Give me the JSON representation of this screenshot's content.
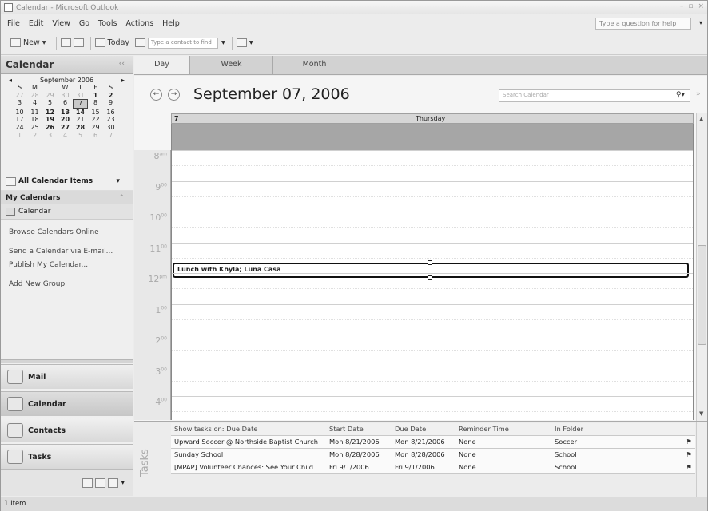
{
  "window": {
    "title": "Calendar - Microsoft Outlook"
  },
  "menu": {
    "items": [
      "File",
      "Edit",
      "View",
      "Go",
      "Tools",
      "Actions",
      "Help"
    ],
    "help_placeholder": "Type a question for help"
  },
  "toolbar": {
    "new_label": "New",
    "today_label": "Today",
    "contact_placeholder": "Type a contact to find"
  },
  "nav": {
    "header": "Calendar",
    "mini_calendar": {
      "month_label": "September 2006",
      "weekdays": [
        "S",
        "M",
        "T",
        "W",
        "T",
        "F",
        "S"
      ],
      "weeks": [
        [
          "27",
          "28",
          "29",
          "30",
          "31",
          "1",
          "2"
        ],
        [
          "3",
          "4",
          "5",
          "6",
          "7",
          "8",
          "9"
        ],
        [
          "10",
          "11",
          "12",
          "13",
          "14",
          "15",
          "16"
        ],
        [
          "17",
          "18",
          "19",
          "20",
          "21",
          "22",
          "23"
        ],
        [
          "24",
          "25",
          "26",
          "27",
          "28",
          "29",
          "30"
        ],
        [
          "1",
          "2",
          "3",
          "4",
          "5",
          "6",
          "7"
        ]
      ]
    },
    "all_items_label": "All Calendar Items",
    "my_calendars_label": "My Calendars",
    "calendar_item": "Calendar",
    "links": [
      "Browse Calendars Online",
      "Send a Calendar via E-mail...",
      "Publish My Calendar...",
      "Add New Group"
    ],
    "buttons": {
      "mail": "Mail",
      "calendar": "Calendar",
      "contacts": "Contacts",
      "tasks": "Tasks"
    }
  },
  "view_tabs": [
    "Day",
    "Week",
    "Month"
  ],
  "calendar": {
    "date_title": "September 07, 2006",
    "search_placeholder": "Search Calendar",
    "day_number": "7",
    "day_name": "Thursday",
    "hours": [
      {
        "h": "8",
        "s": "am"
      },
      {
        "h": "9",
        "s": "00"
      },
      {
        "h": "10",
        "s": "00"
      },
      {
        "h": "11",
        "s": "00"
      },
      {
        "h": "12",
        "s": "pm"
      },
      {
        "h": "1",
        "s": "00"
      },
      {
        "h": "2",
        "s": "00"
      },
      {
        "h": "3",
        "s": "00"
      },
      {
        "h": "4",
        "s": "00"
      }
    ],
    "appointment": "Lunch with Khyla; Luna Casa"
  },
  "tasks": {
    "side_label": "Tasks",
    "headers": {
      "subject": "Show tasks on: Due Date",
      "start": "Start Date",
      "due": "Due Date",
      "reminder": "Reminder Time",
      "folder": "In Folder"
    },
    "rows": [
      {
        "subject": "Upward Soccer @ Northside Baptist Church",
        "start": "Mon 8/21/2006",
        "due": "Mon 8/21/2006",
        "reminder": "None",
        "folder": "Soccer"
      },
      {
        "subject": "Sunday School",
        "start": "Mon 8/28/2006",
        "due": "Mon 8/28/2006",
        "reminder": "None",
        "folder": "School"
      },
      {
        "subject": "[MPAP] Volunteer Chances: See Your Child ...",
        "start": "Fri 9/1/2006",
        "due": "Fri 9/1/2006",
        "reminder": "None",
        "folder": "School"
      }
    ]
  },
  "status": {
    "text": "1 Item"
  }
}
